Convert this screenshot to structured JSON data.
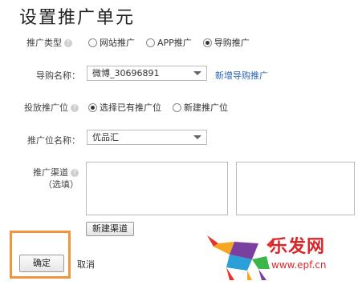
{
  "page": {
    "title": "设置推广单元"
  },
  "promo_type": {
    "label": "推广类型",
    "options": [
      "网站推广",
      "APP推广",
      "导购推广"
    ],
    "selected": "导购推广"
  },
  "guide_name": {
    "label": "导购名称：",
    "value": "微博_30696891",
    "new_link": "新增导购推广"
  },
  "placement": {
    "label": "投放推广位",
    "options": [
      "选择已有推广位",
      "新建推广位"
    ],
    "selected": "选择已有推广位"
  },
  "placement_name": {
    "label": "推广位名称：",
    "value": "优品汇"
  },
  "channel": {
    "label": "推广渠道",
    "optional": "（选填）",
    "new_button": "新建渠道"
  },
  "actions": {
    "confirm": "确定",
    "cancel": "取消"
  },
  "watermark": {
    "logo_text": "乐发网",
    "url": "www.epf.cn"
  },
  "colors": {
    "link": "#2b65b5",
    "highlight_border": "#f0953d",
    "watermark_red": "#d8262b"
  }
}
